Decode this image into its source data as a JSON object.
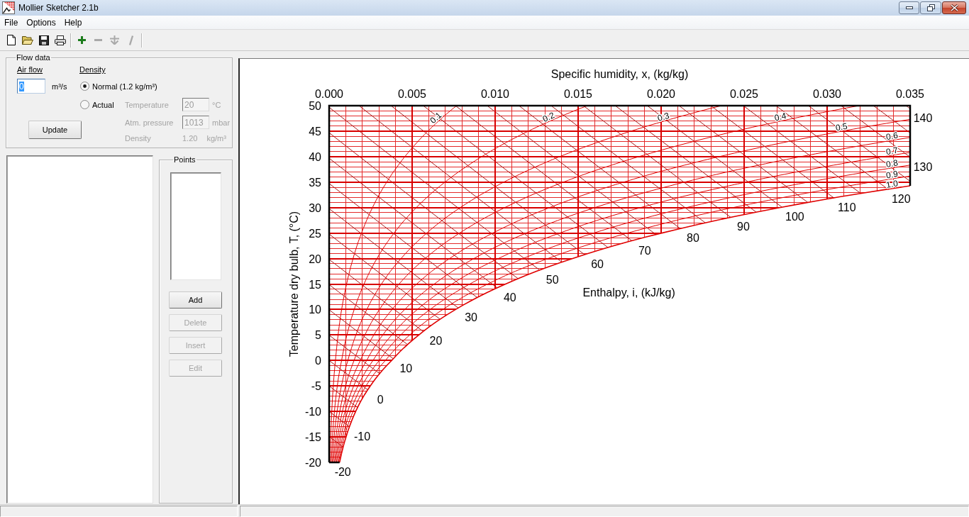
{
  "window": {
    "title": "Mollier Sketcher 2.1b"
  },
  "menu": [
    "File",
    "Options",
    "Help"
  ],
  "toolbar": {
    "groups": [
      {
        "buttons": [
          {
            "kind": "new",
            "disabled": false
          },
          {
            "kind": "open",
            "disabled": false
          },
          {
            "kind": "save",
            "disabled": false
          },
          {
            "kind": "print",
            "disabled": false
          }
        ]
      },
      {
        "buttons": [
          {
            "kind": "add",
            "disabled": false
          },
          {
            "kind": "remove",
            "disabled": true
          },
          {
            "kind": "insert",
            "disabled": true
          },
          {
            "kind": "edit",
            "disabled": true
          }
        ]
      }
    ]
  },
  "flow_data": {
    "title": "Flow data",
    "air_flow": {
      "label": "Air flow",
      "value": "0",
      "unit": "m³/s",
      "focused": true
    },
    "density": {
      "label": "Density",
      "options": [
        {
          "label": "Normal (1.2 kg/m³)",
          "selected": true
        },
        {
          "label": "Actual",
          "selected": false
        }
      ]
    },
    "actual_fields": [
      {
        "label": "Temperature",
        "value": "20",
        "unit": "°C",
        "disabled": true
      },
      {
        "label": "Atm. pressure",
        "value": "1013",
        "unit": "mbar",
        "disabled": true
      }
    ],
    "density_readout": {
      "label": "Density",
      "value": "1.20",
      "unit": "kg/m³",
      "disabled": true
    },
    "update_button": "Update"
  },
  "points": {
    "title": "Points",
    "buttons": [
      {
        "label": "Add",
        "disabled": false
      },
      {
        "label": "Delete",
        "disabled": true
      },
      {
        "label": "Insert",
        "disabled": true
      },
      {
        "label": "Edit",
        "disabled": true
      }
    ]
  },
  "chart": {
    "isenthalp_title": "Enthalpy, i, (kJ/kg)",
    "chart_data": {
      "type": "line",
      "orientation": "horizontal",
      "grid": true,
      "xlabel": "Specific humidity, x, (kg/kg)",
      "ylabel": "Temperature dry bulb, T, (°C)",
      "xlim": [
        0,
        0.035
      ],
      "ylim": [
        -20,
        50
      ],
      "xticks": [
        {
          "value": 0,
          "label": "0.000"
        },
        {
          "value": 0.005,
          "label": "0.005"
        },
        {
          "value": 0.01,
          "label": "0.010"
        },
        {
          "value": 0.015,
          "label": "0.015"
        },
        {
          "value": 0.02,
          "label": "0.020"
        },
        {
          "value": 0.025,
          "label": "0.025"
        },
        {
          "value": 0.03,
          "label": "0.030"
        },
        {
          "value": 0.035,
          "label": "0.035"
        }
      ],
      "yticks": [
        -20,
        -15,
        -10,
        -5,
        0,
        5,
        10,
        15,
        20,
        25,
        30,
        35,
        40,
        45,
        50
      ],
      "x": [
        -20,
        -15,
        -10,
        -5,
        0,
        5,
        10,
        15,
        20,
        25,
        30,
        34.28,
        35,
        36.18,
        38.34,
        40,
        40.83,
        43.76,
        45,
        47.31,
        50
      ],
      "series": [
        {
          "name": "0.1",
          "color": "#e00000",
          "values": [
            6e-05,
            0.0001,
            0.00016,
            0.00025,
            0.00038,
            0.00054,
            0.00075,
            0.00105,
            0.00144,
            0.00195,
            0.00261,
            0.00333,
            0.00347,
            0.0037,
            0.00417,
            0.00456,
            0.00477,
            0.00557,
            0.00595,
            0.0067,
            0.00768
          ]
        },
        {
          "name": "0.2",
          "color": "#e00000",
          "values": [
            0.00013,
            0.0002,
            0.00032,
            0.00049,
            0.00075,
            0.00107,
            0.00151,
            0.0021,
            0.00288,
            0.00391,
            0.00525,
            0.0067,
            0.00698,
            0.00745,
            0.0084,
            0.00919,
            0.00961,
            0.01124,
            0.012,
            0.01354,
            0.01556
          ]
        },
        {
          "name": "0.3",
          "color": "#e00000",
          "values": [
            0.00019,
            0.0003,
            0.00048,
            0.00074,
            0.00113,
            0.00161,
            0.00227,
            0.00315,
            0.00433,
            0.00588,
            0.0079,
            0.0101,
            0.01052,
            0.01125,
            0.01268,
            0.01389,
            0.01453,
            0.01702,
            0.01818,
            0.02054,
            0.02363
          ]
        },
        {
          "name": "0.4",
          "color": "#e00000",
          "values": [
            0.00025,
            0.00041,
            0.00064,
            0.00099,
            0.0015,
            0.00215,
            0.00303,
            0.00421,
            0.00578,
            0.00786,
            0.01058,
            0.01354,
            0.01411,
            0.01508,
            0.01702,
            0.01866,
            0.01953,
            0.0229,
            0.02448,
            0.02769,
            0.03192
          ]
        },
        {
          "name": "0.5",
          "color": "#e00000",
          "values": [
            0.00032,
            0.00051,
            0.0008,
            0.00123,
            0.00188,
            0.00269,
            0.00379,
            0.00527,
            0.00725,
            0.00986,
            0.01328,
            0.01702,
            0.01774,
            0.01897,
            0.02142,
            0.0235,
            0.0246,
            0.0289,
            0.03091,
            0.035,
            null
          ]
        },
        {
          "name": "0.6",
          "color": "#e00000",
          "values": [
            0.00038,
            0.00061,
            0.00096,
            0.00148,
            0.00226,
            0.00323,
            0.00455,
            0.00633,
            0.00872,
            0.01187,
            0.01601,
            0.02054,
            0.02141,
            0.0229,
            0.02589,
            0.02841,
            0.02976,
            0.035,
            null,
            null,
            null
          ]
        },
        {
          "name": "0.7",
          "color": "#e00000",
          "values": [
            0.00044,
            0.00071,
            0.00112,
            0.00173,
            0.00264,
            0.00377,
            0.00531,
            0.0074,
            0.01019,
            0.01389,
            0.01876,
            0.02409,
            0.02512,
            0.02689,
            0.03041,
            0.0334,
            0.035,
            null,
            null,
            null,
            null
          ]
        },
        {
          "name": "0.8",
          "color": "#e00000",
          "values": [
            0.00051,
            0.00081,
            0.00128,
            0.00197,
            0.00302,
            0.00431,
            0.00608,
            0.00847,
            0.01168,
            0.01593,
            0.02153,
            0.02769,
            0.02887,
            0.03092,
            0.035,
            null,
            null,
            null,
            null,
            null,
            null
          ]
        },
        {
          "name": "0.9",
          "color": "#e00000",
          "values": [
            0.00057,
            0.00091,
            0.00144,
            0.00222,
            0.00339,
            0.00485,
            0.00685,
            0.00955,
            0.01317,
            0.01798,
            0.02433,
            0.03132,
            0.03267,
            0.035,
            null,
            null,
            null,
            null,
            null,
            null,
            null
          ]
        },
        {
          "name": "1.0",
          "color": "#e00000",
          "values": [
            0.00063,
            0.00102,
            0.0016,
            0.00248,
            0.00377,
            0.0054,
            0.00762,
            0.01063,
            0.01467,
            0.02004,
            0.02715,
            0.035,
            null,
            null,
            null,
            null,
            null,
            null,
            null,
            null,
            null
          ]
        }
      ],
      "annotations": [
        {
          "text": "-20",
          "x": 5e-05,
          "y": -20
        },
        {
          "text": "-10",
          "x": 0.00122,
          "y": -13
        },
        {
          "text": "0",
          "x": 0.00232,
          "y": -5.75
        },
        {
          "text": "10",
          "x": 0.00386,
          "y": 0.35
        },
        {
          "text": "20",
          "x": 0.00566,
          "y": 5.7
        },
        {
          "text": "30",
          "x": 0.00778,
          "y": 10.3
        },
        {
          "text": "40",
          "x": 0.01012,
          "y": 14.26
        },
        {
          "text": "50",
          "x": 0.01268,
          "y": 17.74
        },
        {
          "text": "60",
          "x": 0.01539,
          "y": 20.77
        },
        {
          "text": "70",
          "x": 0.01824,
          "y": 23.49
        },
        {
          "text": "80",
          "x": 0.02115,
          "y": 25.89
        },
        {
          "text": "90",
          "x": 0.02419,
          "y": 28.1
        },
        {
          "text": "100",
          "x": 0.02728,
          "y": 30.08
        },
        {
          "text": "110",
          "x": 0.03042,
          "y": 31.87
        },
        {
          "text": "120",
          "x": 0.03369,
          "y": 33.55
        },
        "130",
        "140"
      ]
    }
  }
}
